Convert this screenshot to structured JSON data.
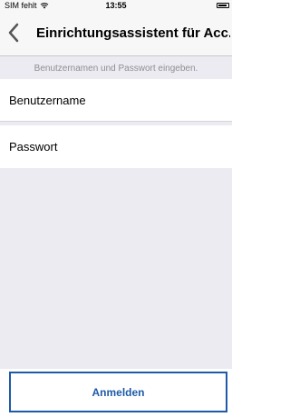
{
  "status_bar": {
    "carrier": "SIM fehlt",
    "time": "13:55"
  },
  "nav": {
    "title": "Einrichtungsassistent für Acc..."
  },
  "form": {
    "instruction": "Benutzernamen und Passwort eingeben.",
    "username_placeholder": "Benutzername",
    "password_placeholder": "Passwort"
  },
  "actions": {
    "login_label": "Anmelden"
  },
  "colors": {
    "accent": "#1e5aa8",
    "background": "#ebebf1"
  }
}
